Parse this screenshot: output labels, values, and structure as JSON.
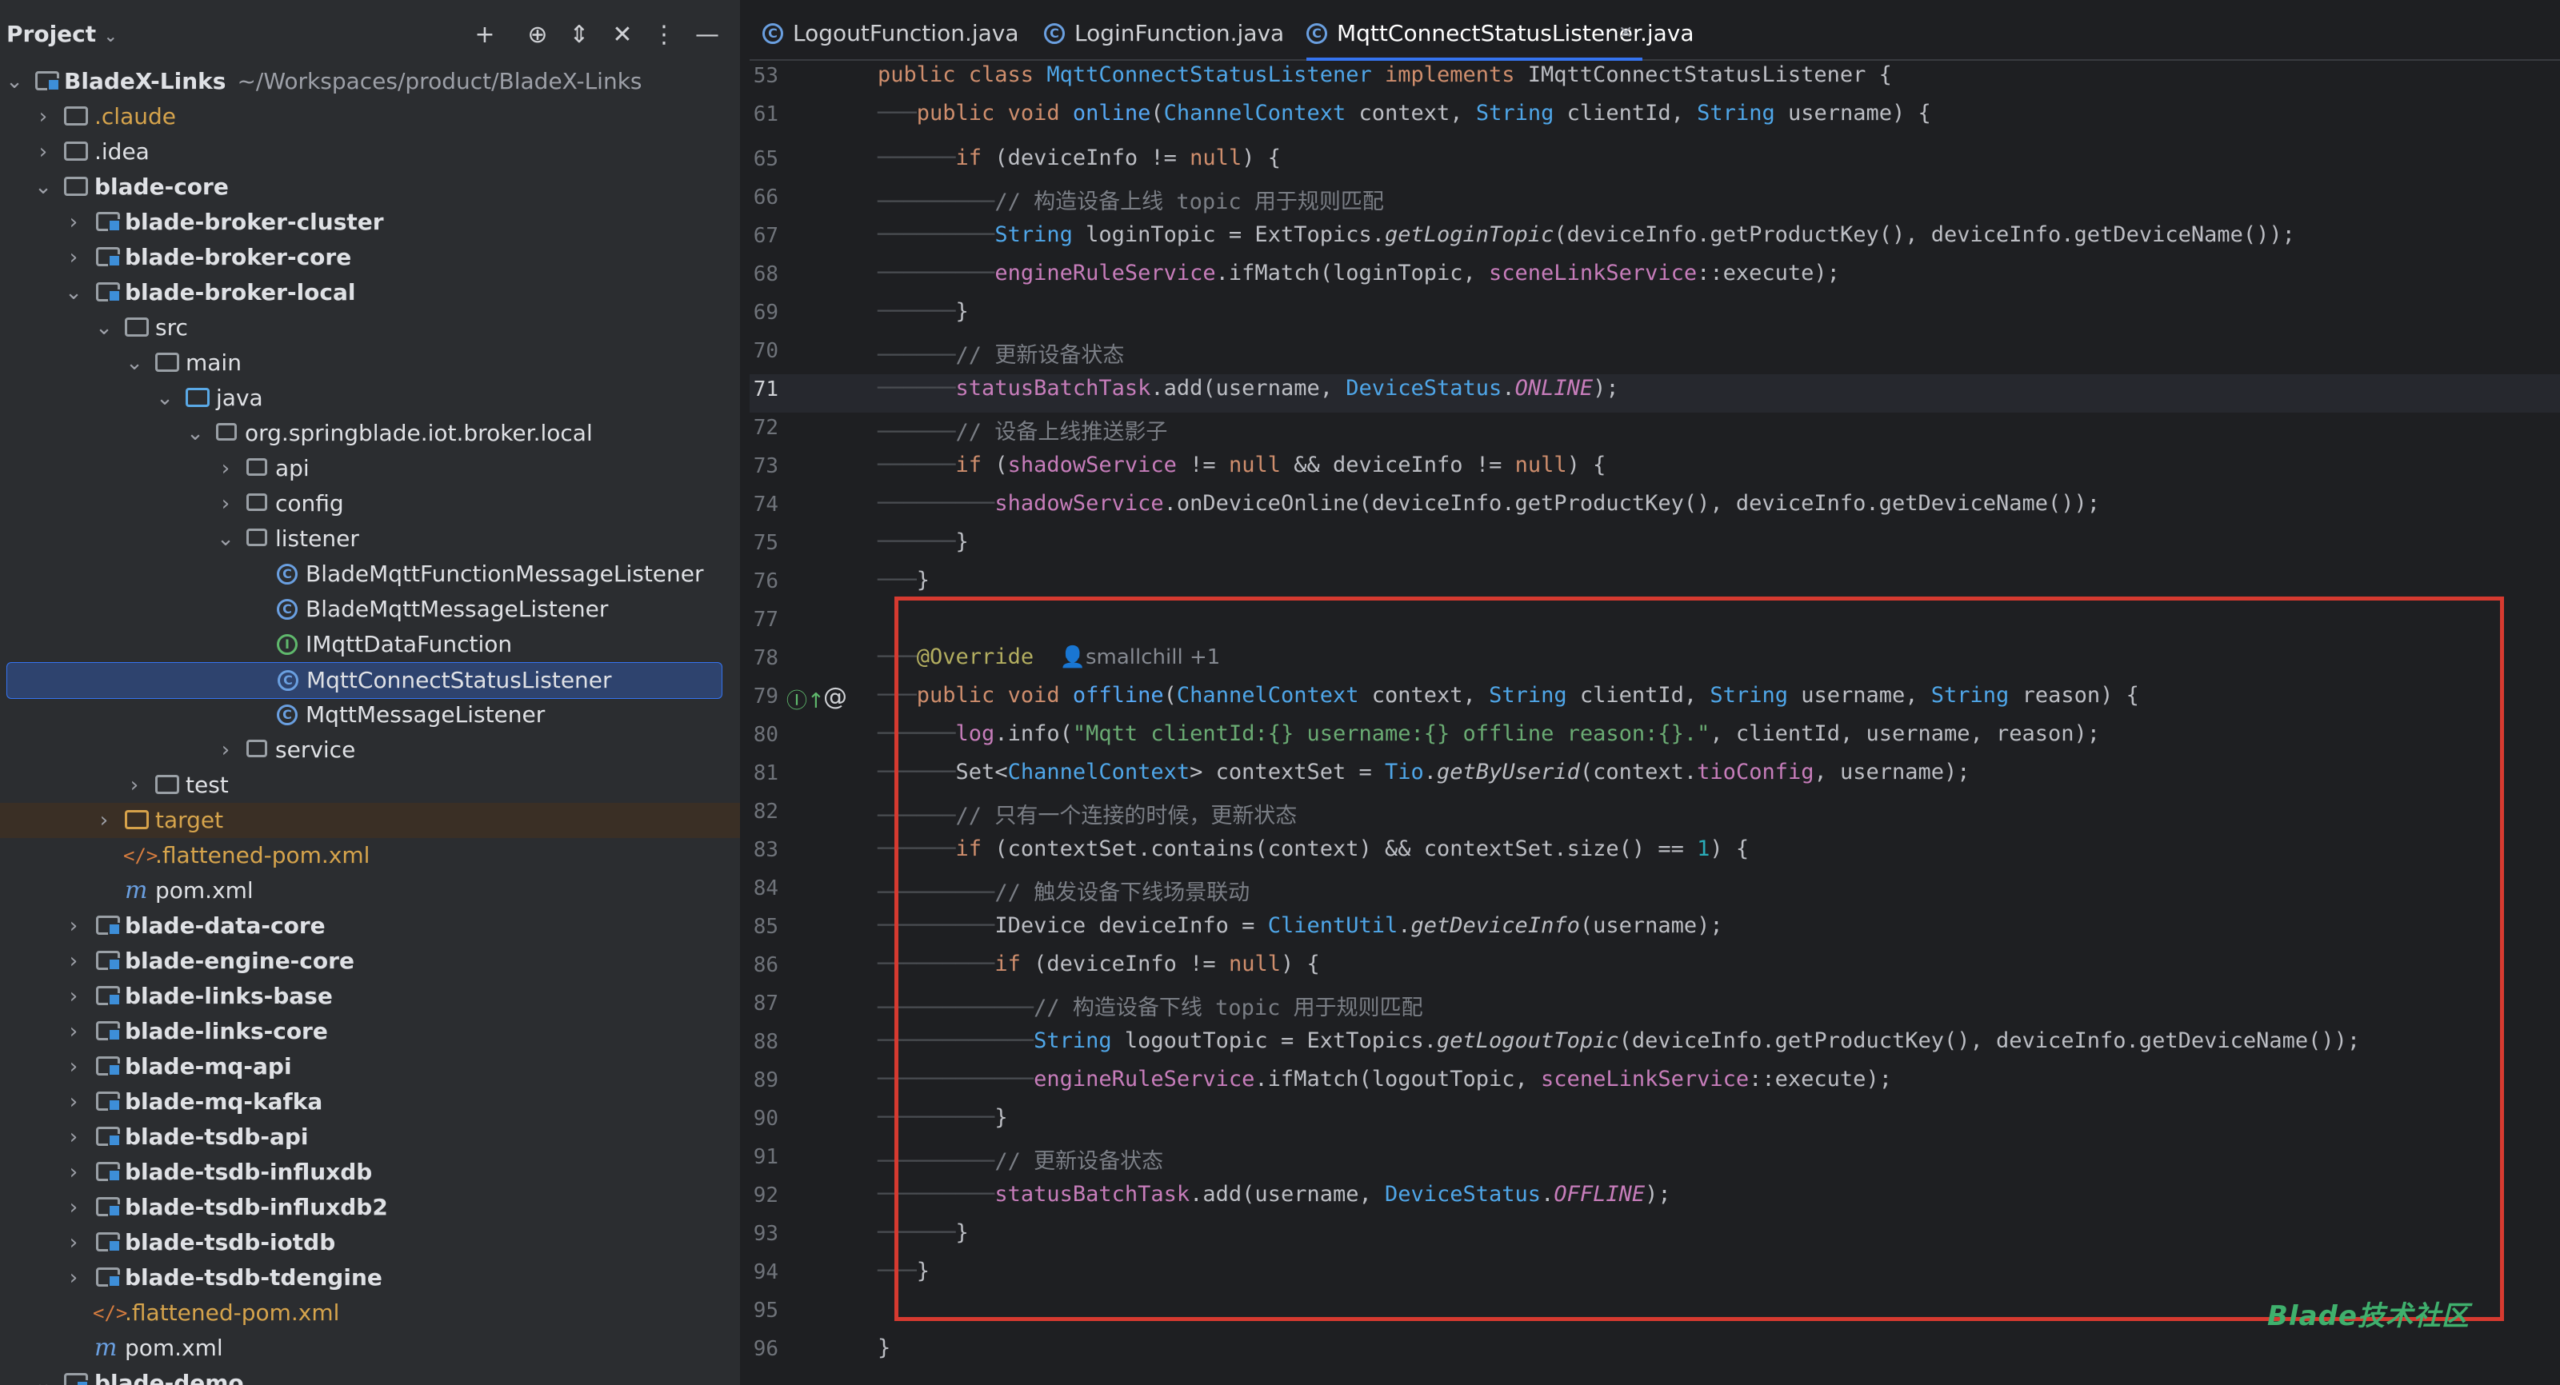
{
  "sidebar": {
    "title": "Project",
    "tree": [
      {
        "label": "BladeX-Links",
        "path": "~/Workspaces/product/BladeX-Links",
        "bold": true
      },
      {
        "label": ".claude",
        "color": "orange"
      },
      {
        "label": ".idea"
      },
      {
        "label": "blade-core",
        "bold": true
      },
      {
        "label": "blade-broker-cluster",
        "bold": true
      },
      {
        "label": "blade-broker-core",
        "bold": true
      },
      {
        "label": "blade-broker-local",
        "bold": true
      },
      {
        "label": "src"
      },
      {
        "label": "main"
      },
      {
        "label": "java"
      },
      {
        "label": "org.springblade.iot.broker.local"
      },
      {
        "label": "api"
      },
      {
        "label": "config"
      },
      {
        "label": "listener"
      },
      {
        "label": "BladeMqttFunctionMessageListener"
      },
      {
        "label": "BladeMqttMessageListener"
      },
      {
        "label": "IMqttDataFunction"
      },
      {
        "label": "MqttConnectStatusListener"
      },
      {
        "label": "MqttMessageListener"
      },
      {
        "label": "service"
      },
      {
        "label": "test"
      },
      {
        "label": "target",
        "color": "orange"
      },
      {
        "label": ".flattened-pom.xml",
        "color": "orange"
      },
      {
        "label": "pom.xml"
      },
      {
        "label": "blade-data-core",
        "bold": true
      },
      {
        "label": "blade-engine-core",
        "bold": true
      },
      {
        "label": "blade-links-base",
        "bold": true
      },
      {
        "label": "blade-links-core",
        "bold": true
      },
      {
        "label": "blade-mq-api",
        "bold": true
      },
      {
        "label": "blade-mq-kafka",
        "bold": true
      },
      {
        "label": "blade-tsdb-api",
        "bold": true
      },
      {
        "label": "blade-tsdb-influxdb",
        "bold": true
      },
      {
        "label": "blade-tsdb-influxdb2",
        "bold": true
      },
      {
        "label": "blade-tsdb-iotdb",
        "bold": true
      },
      {
        "label": "blade-tsdb-tdengine",
        "bold": true
      },
      {
        "label": ".flattened-pom.xml",
        "color": "orange"
      },
      {
        "label": "pom.xml"
      },
      {
        "label": "blade-demo",
        "bold": true
      }
    ]
  },
  "tabs": [
    {
      "label": "LogoutFunction.java"
    },
    {
      "label": "LoginFunction.java"
    },
    {
      "label": "MqttConnectStatusListener.java",
      "active": true
    }
  ],
  "code": {
    "line_numbers": [
      "53",
      "61",
      "65",
      "66",
      "67",
      "68",
      "69",
      "70",
      "71",
      "72",
      "73",
      "74",
      "75",
      "76",
      "77",
      "78",
      "79",
      "80",
      "81",
      "82",
      "83",
      "84",
      "85",
      "86",
      "87",
      "88",
      "89",
      "90",
      "91",
      "92",
      "93",
      "94",
      "95",
      "96"
    ],
    "current_line": "71",
    "author_hint": "smallchill +1",
    "comments": {
      "c66": "// 构造设备上线 topic 用于规则匹配",
      "c70": "// 更新设备状态",
      "c72": "// 设备上线推送影子",
      "c82": "// 只有一个连接的时候，更新状态",
      "c84": "// 触发设备下线场景联动",
      "c87": "// 构造设备下线 topic 用于规则匹配",
      "c91": "// 更新设备状态"
    },
    "log_string": "\"Mqtt clientId:{} username:{} offline reason:{}.\""
  },
  "watermark": "Blade技术社区",
  "colors": {
    "highlight_box": "#d63a30",
    "selection": "#2e436e",
    "accent": "#3574f0"
  }
}
